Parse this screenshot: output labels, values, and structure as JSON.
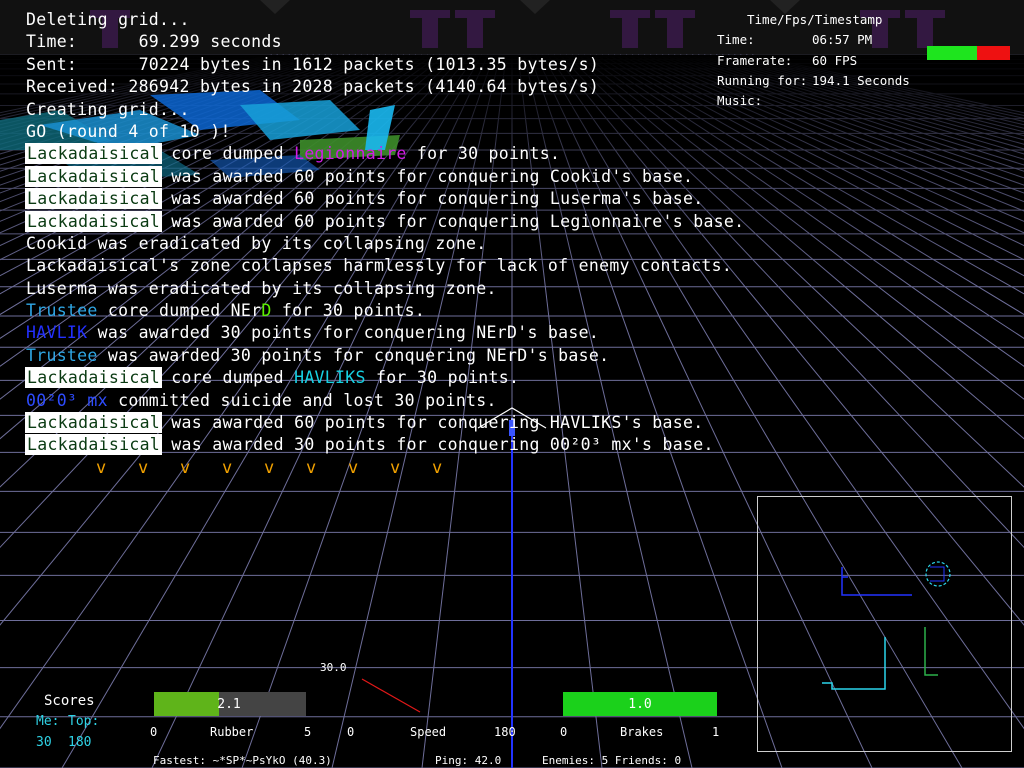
{
  "console_lines": [
    [
      {
        "t": "Deleting grid..."
      }
    ],
    [
      {
        "t": "Time:      69.299 seconds"
      }
    ],
    [
      {
        "t": "Sent:      70224 bytes in 1612 packets (1013.35 bytes/s)"
      }
    ],
    [
      {
        "t": "Received: 286942 bytes in 2028 packets (4140.64 bytes/s)"
      }
    ],
    [
      {
        "t": "Creating grid..."
      }
    ],
    [
      {
        "t": "GO (round 4 of 10 )!"
      }
    ],
    [
      {
        "t": "Lackadaisical",
        "c": "tag"
      },
      {
        "t": " core dumped "
      },
      {
        "t": "Legionnaire",
        "c": "c-magenta"
      },
      {
        "t": " for 30 points."
      }
    ],
    [
      {
        "t": "Lackadaisical",
        "c": "tag"
      },
      {
        "t": " was awarded 60 points for conquering Cookid's base."
      }
    ],
    [
      {
        "t": "Lackadaisical",
        "c": "tag"
      },
      {
        "t": " was awarded 60 points for conquering Luserma's base."
      }
    ],
    [
      {
        "t": "Lackadaisical",
        "c": "tag"
      },
      {
        "t": " was awarded 60 points for conquering Legionnaire's base."
      }
    ],
    [
      {
        "t": "Cookid was eradicated by its collapsing zone."
      }
    ],
    [
      {
        "t": "Lackadaisical's zone collapses harmlessly for lack of enemy contacts."
      }
    ],
    [
      {
        "t": "Luserma was eradicated by its collapsing zone."
      }
    ],
    [
      {
        "t": "Trustee",
        "c": "c-cyan"
      },
      {
        "t": " core dumped NEr"
      },
      {
        "t": "D",
        "c": "c-green"
      },
      {
        "t": " for 30 points."
      }
    ],
    [
      {
        "t": "HAVLIK",
        "c": "c-blue"
      },
      {
        "t": " was awarded 30 points for conquering NErD's base."
      }
    ],
    [
      {
        "t": "Trustee",
        "c": "c-cyan"
      },
      {
        "t": " was awarded 30 points for conquering NErD's base."
      }
    ],
    [
      {
        "t": "Lackadaisical",
        "c": "tag"
      },
      {
        "t": " core dumped "
      },
      {
        "t": "HAVLIKS",
        "c": "c-teal"
      },
      {
        "t": " for 30 points."
      }
    ],
    [
      {
        "t": "00²0³ mx",
        "c": "c-dim"
      },
      {
        "t": " committed suicide and lost 30 points."
      }
    ],
    [
      {
        "t": "Lackadaisical",
        "c": "tag"
      },
      {
        "t": " was awarded 60 points for conquering HAVLIKS's base."
      }
    ],
    [
      {
        "t": "Lackadaisical",
        "c": "tag"
      },
      {
        "t": " was awarded 30 points for conquering 00²0³ mx's base."
      }
    ]
  ],
  "info": {
    "title": "Time/Fps/Timestamp",
    "time_label": "Time:",
    "time_value": "06:57 PM",
    "framerate_label": "Framerate:",
    "framerate_value": "60 FPS",
    "running_label": "Running for:",
    "running_value": "194.1 Seconds",
    "music_label": "Music:"
  },
  "scores": {
    "title": "Scores",
    "me_label": "Me:",
    "top_label": "Top:",
    "me_value": "30",
    "top_value": "180"
  },
  "rubber": {
    "value_text": "2.1",
    "fill_fraction": 0.43,
    "min": "0",
    "label": "Rubber",
    "max": "5"
  },
  "speed": {
    "top_value": "30.0",
    "min": "0",
    "label": "Speed",
    "max": "180"
  },
  "brakes": {
    "value_text": "1.0",
    "fill_fraction": 1.0,
    "min": "0",
    "label": "Brakes",
    "max": "1"
  },
  "footer": {
    "fastest": "Fastest: ~*SP*~PsYkO (40.3)",
    "ping": "Ping: 42.0",
    "enemies_friends": "Enemies: 5 Friends: 0"
  },
  "chevron_count": 9,
  "health_bar": {
    "green_fraction": 0.6,
    "color_good": "#1ee51e",
    "color_bad": "#ee1111"
  },
  "colors": {
    "grid": "#6e6e9a",
    "accent_blue": "#2330ff",
    "hud_green": "#5fb41a"
  }
}
